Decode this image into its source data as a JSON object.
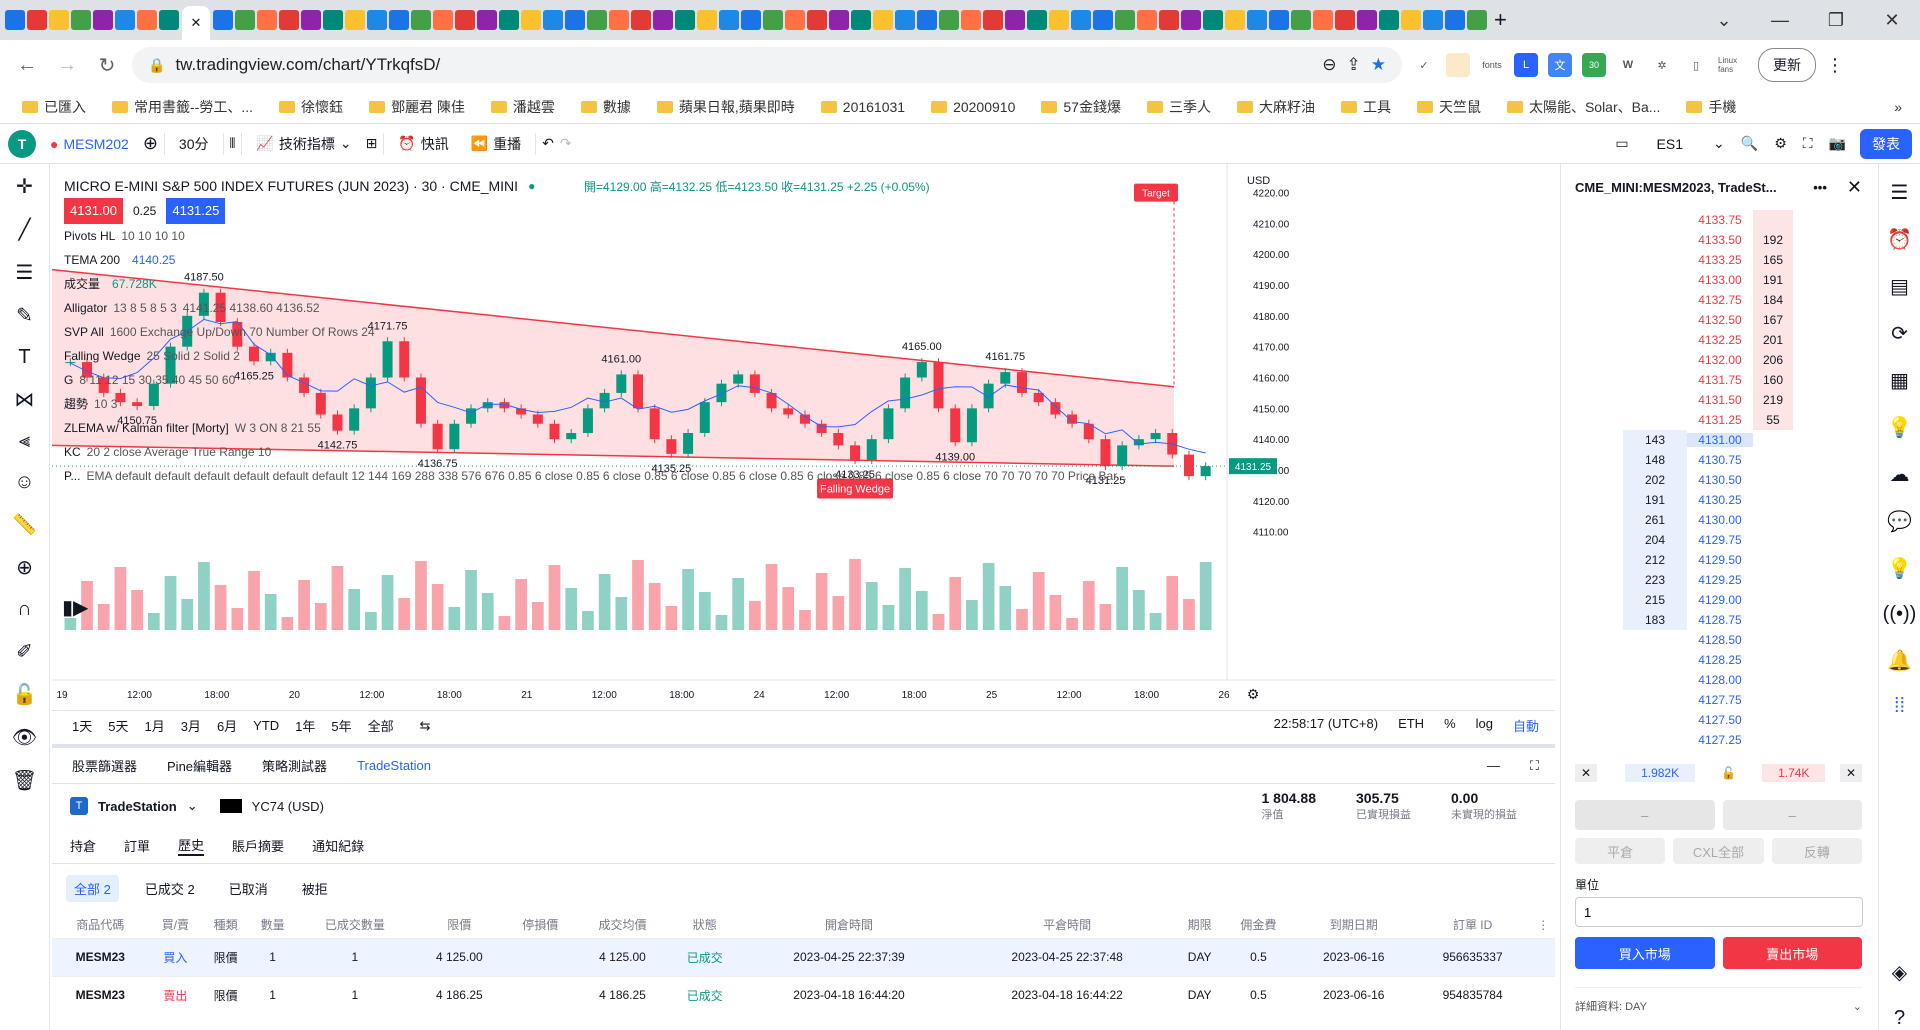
{
  "browser": {
    "url": "tw.tradingview.com/chart/YTrkqfsD/",
    "update_label": "更新",
    "ext_fonts": "fonts",
    "ext_badge": "30",
    "ext_linux": "Linux fans",
    "bookmarks": [
      "已匯入",
      "常用書籤--勞工、...",
      "徐懷鈺",
      "鄧麗君 陳佳",
      "潘越雲",
      "數據",
      "蘋果日報,蘋果即時",
      "20161031",
      "20200910",
      "57金錢爆",
      "三季人",
      "大麻籽油",
      "工具",
      "天竺鼠",
      "太陽能、Solar、Ba...",
      "手機"
    ]
  },
  "toolbar": {
    "avatar": "T",
    "symbol": "MESM202",
    "interval": "30分",
    "indicators": "技術指標",
    "alert": "快訊",
    "replay": "重播",
    "compare_symbol": "ES1",
    "publish": "發表"
  },
  "chart": {
    "title": "MICRO E-MINI S&P 500 INDEX FUTURES (JUN 2023) · 30 · CME_MINI",
    "ohlc": "開=4129.00 高=4132.25 低=4123.50 收=4131.25 +2.25 (+0.05%)",
    "sell_price": "4131.00",
    "spread": "0.25",
    "buy_price": "4131.25",
    "indicators": [
      {
        "name": "Pivots HL",
        "params": "10 10 10 10",
        "value": ""
      },
      {
        "name": "TEMA 200",
        "params": "",
        "value": "4140.25"
      },
      {
        "name": "成交量",
        "params": "",
        "value": "67.728K"
      },
      {
        "name": "Alligator",
        "params": "13 8 5 8 5 3",
        "value": "4141.25 4138.60 4136.52"
      },
      {
        "name": "SVP All",
        "params": "1600 Exchange Up/Down 70 Number Of Rows 24",
        "value": ""
      },
      {
        "name": "Falling Wedge",
        "params": "25 Solid 2 Solid 2",
        "value": ""
      },
      {
        "name": "G",
        "params": "8 11 12 15 30 35 40 45 50 60",
        "value": ""
      },
      {
        "name": "趨勢",
        "params": "10 3",
        "value": ""
      },
      {
        "name": "ZLEMA w/ Kalman filter [Morty]",
        "params": "W 3 ON 8 21 55",
        "value": ""
      },
      {
        "name": "KC",
        "params": "20 2 close Average True Range 10",
        "value": ""
      },
      {
        "name": "P...",
        "params": "EMA default default default default default default 12 144 169 288 338 576 676 0.85 6 close 0.85 6 close 0.85 6 close 0.85 6 close 0.85 6 close 0.85 6 close 0.85 6 close 70 70 70 70 70 Price Bar...",
        "value": ""
      }
    ],
    "currency": "USD",
    "price_ticks": [
      "4220.00",
      "4210.00",
      "4200.00",
      "4190.00",
      "4180.00",
      "4170.00",
      "4160.00",
      "4150.00",
      "4140.00",
      "4130.00",
      "4120.00",
      "4110.00"
    ],
    "current_price_tag": "4131.25",
    "target_label": "Target",
    "wedge_label": "Falling Wedge",
    "pivot_labels": [
      "4187.50",
      "4171.75",
      "4165.25",
      "4150.75",
      "4142.75",
      "4136.75",
      "4161.00",
      "4135.25",
      "4165.00",
      "4161.75",
      "4133.25",
      "4139.00",
      "4131.25"
    ],
    "time_ticks": [
      "19",
      "12:00",
      "18:00",
      "20",
      "12:00",
      "18:00",
      "21",
      "12:00",
      "18:00",
      "24",
      "12:00",
      "18:00",
      "25",
      "12:00",
      "18:00",
      "26"
    ],
    "ranges": [
      "1天",
      "5天",
      "1月",
      "3月",
      "6月",
      "YTD",
      "1年",
      "5年",
      "全部"
    ],
    "clock": "22:58:17 (UTC+8)",
    "session": "ETH",
    "pct": "%",
    "log": "log",
    "auto": "自動",
    "colors": {
      "up": "#089981",
      "down": "#f23645",
      "wedge": "#f23645",
      "wedge_fill": "#fdd5d8",
      "tema": "#2962ff"
    }
  },
  "chart_data": {
    "type": "line",
    "title": "MICRO E-MINI S&P 500 INDEX FUTURES (JUN 2023) · 30 · CME_MINI",
    "ylim": [
      4106,
      4226
    ],
    "series": [
      {
        "name": "",
        "values": [
          4165,
          4160,
          4155,
          4152,
          4150.75,
          4158,
          4170,
          4180,
          4187.5,
          4178,
          4170,
          4165.25,
          4168,
          4160,
          4155,
          4148,
          4142.75,
          4150,
          4160,
          4171.75,
          4160,
          4145,
          4136.75,
          4145,
          4150,
          4152,
          4150,
          4148,
          4145,
          4140,
          4142,
          4150,
          4155,
          4161,
          4150,
          4140,
          4135.25,
          4142,
          4152,
          4158,
          4161,
          4155,
          4150,
          4148,
          4145,
          4142,
          4138,
          4133.25,
          4140,
          4150,
          4160,
          4165,
          4150,
          4139,
          4150,
          4158,
          4161.75,
          4155,
          4152,
          4148,
          4145,
          4140,
          4131.25,
          4138,
          4140,
          4142,
          4135,
          4128,
          4131.25
        ]
      }
    ]
  },
  "bottom": {
    "tabs": [
      "股票篩選器",
      "Pine編輯器",
      "策略測試器",
      "TradeStation"
    ],
    "broker_name": "TradeStation",
    "account": "YC74 (USD)",
    "stats": [
      {
        "value": "1 804.88",
        "label": "淨值"
      },
      {
        "value": "305.75",
        "label": "已實現損益"
      },
      {
        "value": "0.00",
        "label": "未實現的損益"
      }
    ],
    "subtabs": [
      "持倉",
      "訂單",
      "歷史",
      "賬戶摘要",
      "通知紀錄"
    ],
    "filters": [
      "全部 2",
      "已成交 2",
      "已取消",
      "被拒"
    ],
    "columns": [
      "商品代碼",
      "買/賣",
      "種類",
      "數量",
      "已成交數量",
      "限價",
      "停損價",
      "成交均價",
      "狀態",
      "開倉時間",
      "平倉時間",
      "期限",
      "佣金費",
      "到期日期",
      "訂單 ID"
    ],
    "rows": [
      [
        "MESM23",
        "買入",
        "限價",
        "1",
        "1",
        "4 125.00",
        "",
        "4 125.00",
        "已成交",
        "2023-04-25 22:37:39",
        "2023-04-25 22:37:48",
        "DAY",
        "0.5",
        "2023-06-16",
        "956635337"
      ],
      [
        "MESM23",
        "賣出",
        "限價",
        "1",
        "1",
        "4 186.25",
        "",
        "4 186.25",
        "已成交",
        "2023-04-18 16:44:20",
        "2023-04-18 16:44:22",
        "DAY",
        "0.5",
        "2023-06-16",
        "954835784"
      ]
    ]
  },
  "dom": {
    "title": "CME_MINI:MESM2023, TradeSt...",
    "rows": [
      {
        "bid": "",
        "price": "4133.75",
        "ask": ""
      },
      {
        "bid": "",
        "price": "4133.50",
        "ask": "192"
      },
      {
        "bid": "",
        "price": "4133.25",
        "ask": "165"
      },
      {
        "bid": "",
        "price": "4133.00",
        "ask": "191"
      },
      {
        "bid": "",
        "price": "4132.75",
        "ask": "184"
      },
      {
        "bid": "",
        "price": "4132.50",
        "ask": "167"
      },
      {
        "bid": "",
        "price": "4132.25",
        "ask": "201"
      },
      {
        "bid": "",
        "price": "4132.00",
        "ask": "206"
      },
      {
        "bid": "",
        "price": "4131.75",
        "ask": "160"
      },
      {
        "bid": "",
        "price": "4131.50",
        "ask": "219"
      },
      {
        "bid": "",
        "price": "4131.25",
        "ask": "55"
      },
      {
        "bid": "143",
        "price": "4131.00",
        "ask": ""
      },
      {
        "bid": "148",
        "price": "4130.75",
        "ask": ""
      },
      {
        "bid": "202",
        "price": "4130.50",
        "ask": ""
      },
      {
        "bid": "191",
        "price": "4130.25",
        "ask": ""
      },
      {
        "bid": "261",
        "price": "4130.00",
        "ask": ""
      },
      {
        "bid": "204",
        "price": "4129.75",
        "ask": ""
      },
      {
        "bid": "212",
        "price": "4129.50",
        "ask": ""
      },
      {
        "bid": "223",
        "price": "4129.25",
        "ask": ""
      },
      {
        "bid": "215",
        "price": "4129.00",
        "ask": ""
      },
      {
        "bid": "183",
        "price": "4128.75",
        "ask": ""
      },
      {
        "bid": "",
        "price": "4128.50",
        "ask": ""
      },
      {
        "bid": "",
        "price": "4128.25",
        "ask": ""
      },
      {
        "bid": "",
        "price": "4128.00",
        "ask": ""
      },
      {
        "bid": "",
        "price": "4127.75",
        "ask": ""
      },
      {
        "bid": "",
        "price": "4127.50",
        "ask": ""
      },
      {
        "bid": "",
        "price": "4127.25",
        "ask": ""
      }
    ],
    "bid_total": "1.982K",
    "ask_total": "1.74K",
    "flatten": "平倉",
    "cancel_all": "CXL全部",
    "reverse": "反轉",
    "units_label": "單位",
    "units_value": "1",
    "buy_market": "買入市場",
    "sell_market": "賣出市場",
    "details": "詳細資料: DAY",
    "dash": "–"
  }
}
